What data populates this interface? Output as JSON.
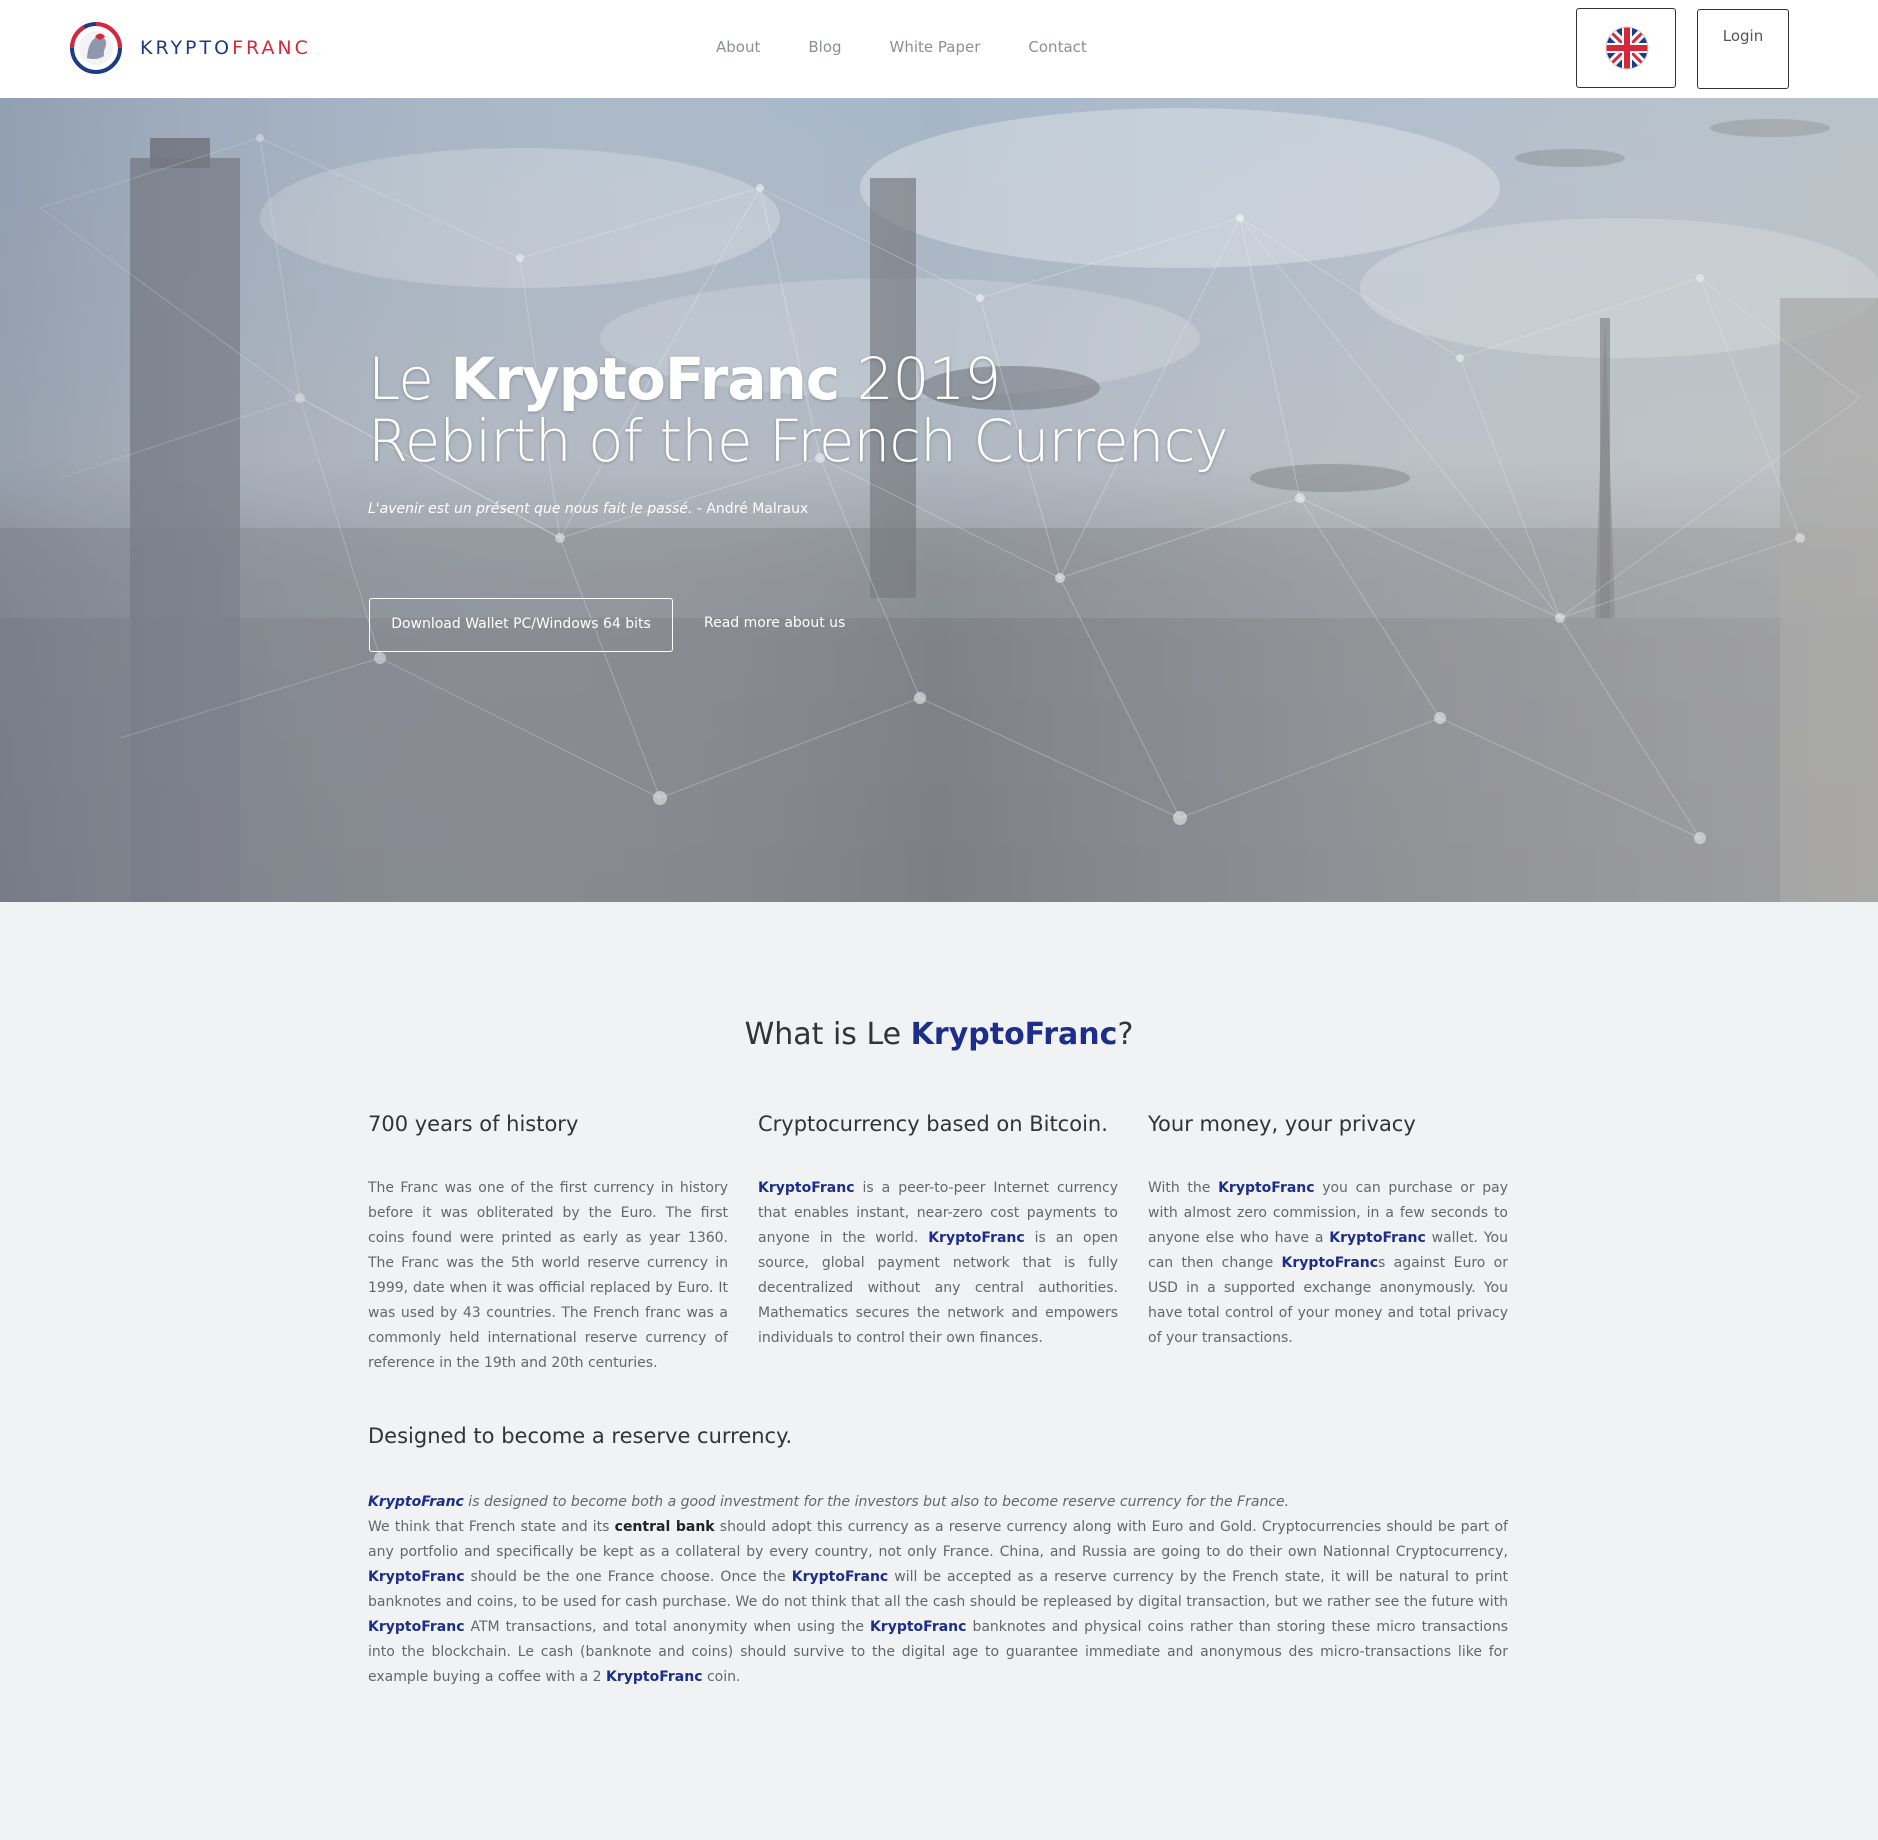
{
  "header": {
    "logo_prefix": "KRYPTO",
    "logo_suffix": "FRANC",
    "nav": [
      "About",
      "Blog",
      "White Paper",
      "Contact"
    ],
    "login_label": "Login",
    "language_flag": "uk-flag-icon"
  },
  "hero": {
    "title_le": "Le ",
    "title_brand": "KryptoFranc",
    "title_year": " 2019",
    "title_line2": "Rebirth of the French Currency",
    "quote": "L'avenir est un présent que nous fait le passé.",
    "quote_author": " - André Malraux",
    "download_label": "Download Wallet PC/Windows 64 bits",
    "readmore_label": "Read more about us"
  },
  "what_is": {
    "title_prefix": "What is Le ",
    "title_brand": "KryptoFranc",
    "title_suffix": "?"
  },
  "columns": [
    {
      "heading": "700 years of history",
      "text": "The Franc was one of the first currency in history before it was obliterated by the Euro. The first coins found were printed as early as year 1360. The Franc was the 5th world reserve currency in 1999, date when it was official replaced by Euro. It was used by 43 countries. The French franc was a commonly held international reserve currency of reference in the 19th and 20th centuries."
    },
    {
      "heading": "Cryptocurrency based on Bitcoin.",
      "brand1": "KryptoFranc",
      "text1": " is a peer-to-peer Internet currency that enables instant, near-zero cost payments to anyone in the world. ",
      "brand2": "KryptoFranc",
      "text2": " is an open source, global payment network that is fully decentralized without any central authorities. Mathematics secures the network and empowers individuals to control their own finances."
    },
    {
      "heading": "Your money, your privacy",
      "text1": "With the ",
      "brand1": "KryptoFranc",
      "text2": " you can purchase or pay with almost zero commission, in a few seconds to anyone else who have a ",
      "brand2": "KryptoFranc",
      "text3": " wallet. You can then change ",
      "brand3": "KryptoFranc",
      "text4": "s against Euro or USD in a supported exchange anonymously. You have total control of your money and total privacy of your transactions."
    }
  ],
  "designed": {
    "heading": "Designed to become a reserve currency.",
    "lead_brand": "KryptoFranc",
    "lead_text": " is designed to become both a good investment for the investors but also to become reserve currency for the France.",
    "p1": "We think that French state and its ",
    "p1_strong": "central bank",
    "p2": " should adopt this currency as a reserve currency along with Euro and Gold. Cryptocurrencies should be part of any portfolio and specifically be kept as a collateral by every country, not only France. China, and Russia are going to do their own Nationnal Cryptocurrency, ",
    "brand1": "KryptoFranc",
    "p3": " should be the one France choose. Once the ",
    "brand2": "KryptoFranc",
    "p4": " will be accepted as a reserve currency by the French state, it will be natural to print banknotes and coins, to be used for cash purchase. We do not think that all the cash should be repleased by digital transaction, but we rather see the future with ",
    "brand3": "KryptoFranc",
    "p5": " ATM transactions, and total anonymity when using the ",
    "brand4": "KryptoFranc",
    "p6": " banknotes and physical coins rather than storing these micro transactions into the blockchain. Le cash (banknote and coins) should survive to the digital age to guarantee immediate and anonymous des micro-transactions like for example buying a coffee with a 2 ",
    "brand5": "KryptoFranc",
    "p7": " coin."
  },
  "colors": {
    "brand_blue": "#1c2d8a",
    "brand_red": "#d7283b",
    "body_text": "#666666",
    "page_bg": "#f0f2f4"
  }
}
